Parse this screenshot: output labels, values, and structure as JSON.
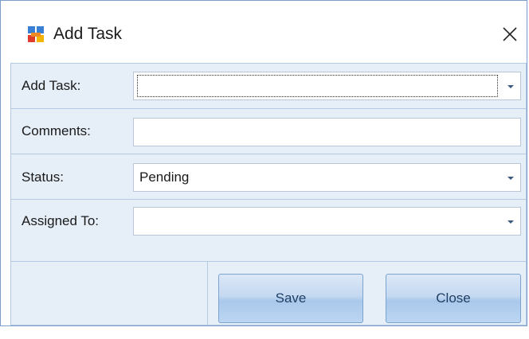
{
  "window": {
    "title": "Add Task"
  },
  "form": {
    "rows": [
      {
        "label": "Add Task:",
        "value": "",
        "type": "dropdown"
      },
      {
        "label": "Comments:",
        "value": "",
        "type": "text"
      },
      {
        "label": "Status:",
        "value": "Pending",
        "type": "dropdown"
      },
      {
        "label": "Assigned To:",
        "value": "",
        "type": "dropdown"
      }
    ]
  },
  "buttons": {
    "save_label": "Save",
    "close_label": "Close"
  },
  "icons": {
    "app": "app-form-icon",
    "close": "close-icon",
    "dropdown": "chevron-down-icon"
  },
  "colors": {
    "form_background": "#e6eef8",
    "border": "#b6c9e2",
    "button_text": "#1e3f66"
  }
}
